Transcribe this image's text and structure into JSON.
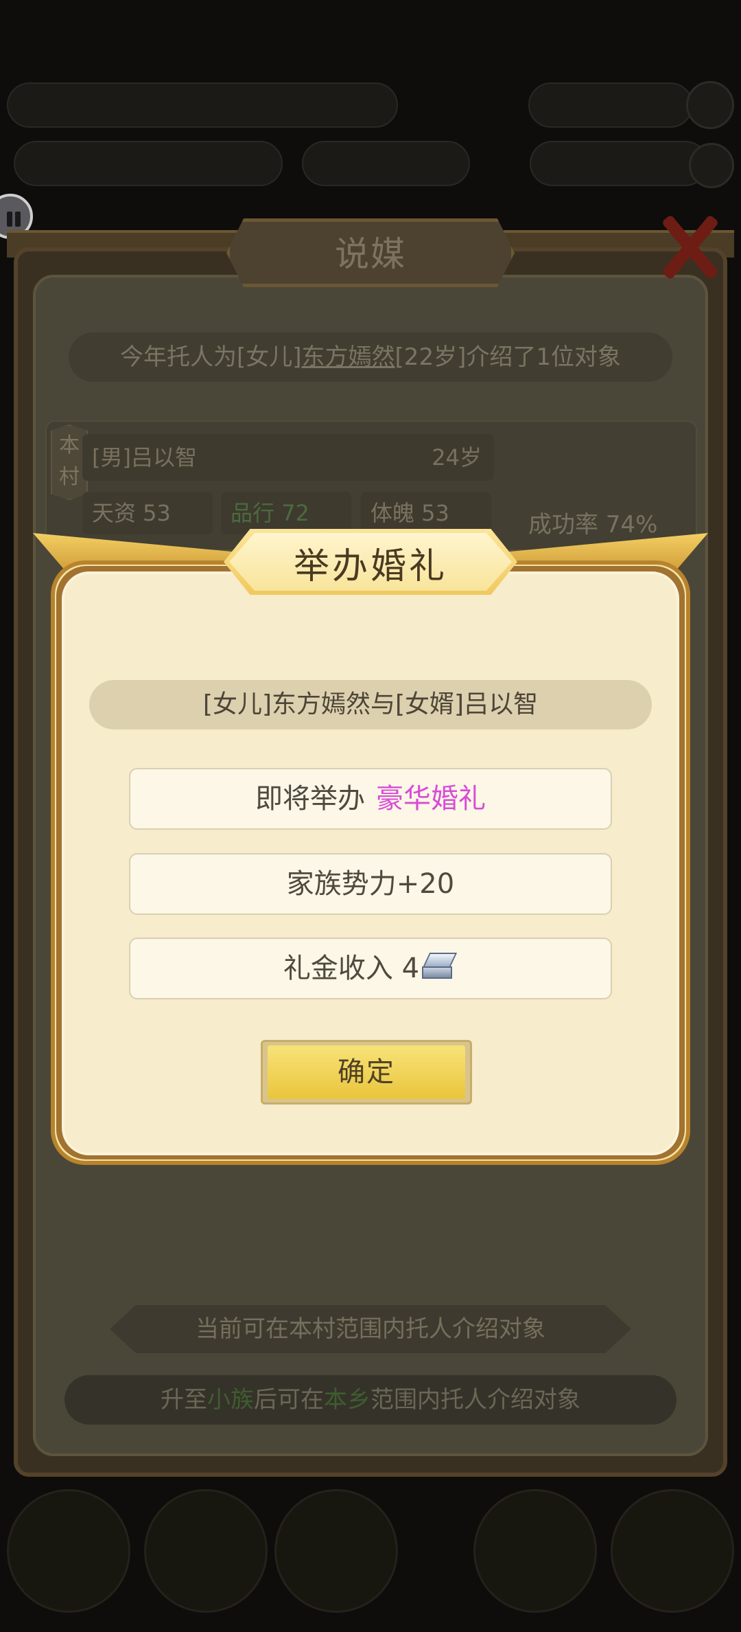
{
  "background": {
    "panel_title": "说媒",
    "info_bar": {
      "prefix": "今年托人为[女儿]",
      "name": "东方嫣然",
      "suffix": "[22岁]介绍了1位对象"
    },
    "candidate": {
      "tag": "本村",
      "name": "[男]吕以智",
      "age": "24岁",
      "stats": [
        {
          "label": "天资 53"
        },
        {
          "label": "品行 72"
        },
        {
          "label": "体魄 53"
        }
      ],
      "success_rate": "成功率 74%"
    },
    "hint_banner": "当前可在本村范围内托人介绍对象",
    "hint_bar": {
      "part1": "升至",
      "highlight1": "小族",
      "part2": "后可在",
      "highlight2": "本乡",
      "part3": "范围内托人介绍对象"
    }
  },
  "modal": {
    "title": "举办婚礼",
    "couple": "[女儿]东方嫣然与[女婿]吕以智",
    "wedding_prefix": "即将举办",
    "wedding_type": "豪华婚礼",
    "influence": "家族势力+20",
    "gift_money": "礼金收入 4",
    "gift_icon": "silver-ingot-icon",
    "confirm": "确定"
  },
  "colors": {
    "highlight_pink": "#d94bd8",
    "button_gold": "#e9c53d",
    "modal_bg": "#f7eccb"
  }
}
